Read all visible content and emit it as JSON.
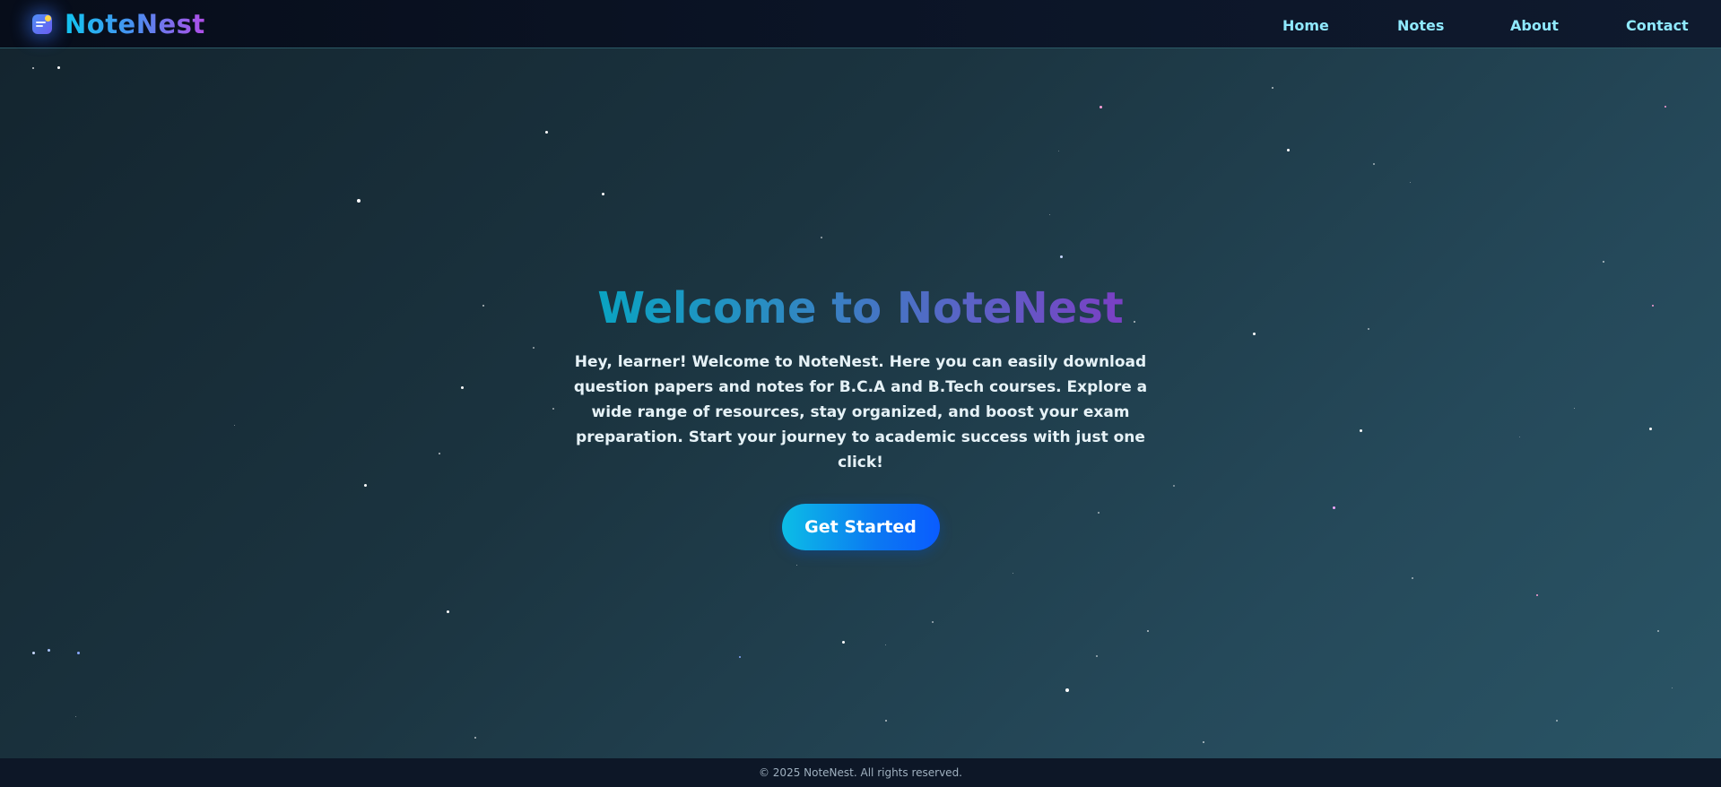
{
  "nav": {
    "brand": "NoteNest",
    "links": [
      "Home",
      "Notes",
      "About",
      "Contact"
    ]
  },
  "hero": {
    "title": "Welcome to NoteNest",
    "text": "Hey, learner! Welcome to NoteNest. Here you can easily download question papers and notes for B.C.A and B.Tech courses. Explore a wide range of resources, stay organized, and boost your exam preparation. Start your journey to academic success with just one click!",
    "cta": "Get Started"
  },
  "footer": {
    "text": "© 2025 NoteNest. All rights reserved."
  },
  "colors": {
    "nav_link": "#8fe9ff",
    "cta_start": "#0cbde6",
    "cta_end": "#0a5cff",
    "footer_bg": "#0d1727"
  },
  "icons": {
    "logo": "notebook-logo-icon"
  }
}
